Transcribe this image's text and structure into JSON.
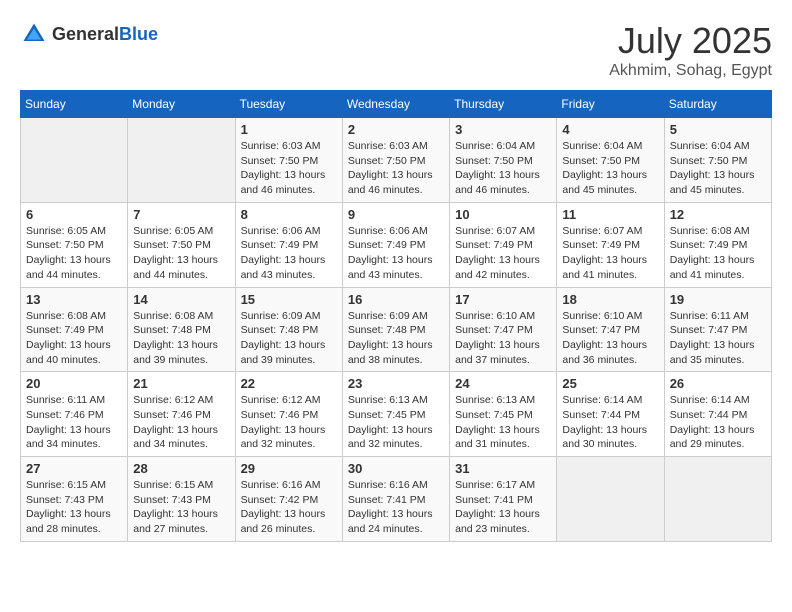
{
  "header": {
    "logo_general": "General",
    "logo_blue": "Blue",
    "title": "July 2025",
    "location": "Akhmim, Sohag, Egypt"
  },
  "weekdays": [
    "Sunday",
    "Monday",
    "Tuesday",
    "Wednesday",
    "Thursday",
    "Friday",
    "Saturday"
  ],
  "weeks": [
    [
      {
        "day": "",
        "empty": true
      },
      {
        "day": "",
        "empty": true
      },
      {
        "day": "1",
        "sunrise": "6:03 AM",
        "sunset": "7:50 PM",
        "daylight": "13 hours and 46 minutes."
      },
      {
        "day": "2",
        "sunrise": "6:03 AM",
        "sunset": "7:50 PM",
        "daylight": "13 hours and 46 minutes."
      },
      {
        "day": "3",
        "sunrise": "6:04 AM",
        "sunset": "7:50 PM",
        "daylight": "13 hours and 46 minutes."
      },
      {
        "day": "4",
        "sunrise": "6:04 AM",
        "sunset": "7:50 PM",
        "daylight": "13 hours and 45 minutes."
      },
      {
        "day": "5",
        "sunrise": "6:04 AM",
        "sunset": "7:50 PM",
        "daylight": "13 hours and 45 minutes."
      }
    ],
    [
      {
        "day": "6",
        "sunrise": "6:05 AM",
        "sunset": "7:50 PM",
        "daylight": "13 hours and 44 minutes."
      },
      {
        "day": "7",
        "sunrise": "6:05 AM",
        "sunset": "7:50 PM",
        "daylight": "13 hours and 44 minutes."
      },
      {
        "day": "8",
        "sunrise": "6:06 AM",
        "sunset": "7:49 PM",
        "daylight": "13 hours and 43 minutes."
      },
      {
        "day": "9",
        "sunrise": "6:06 AM",
        "sunset": "7:49 PM",
        "daylight": "13 hours and 43 minutes."
      },
      {
        "day": "10",
        "sunrise": "6:07 AM",
        "sunset": "7:49 PM",
        "daylight": "13 hours and 42 minutes."
      },
      {
        "day": "11",
        "sunrise": "6:07 AM",
        "sunset": "7:49 PM",
        "daylight": "13 hours and 41 minutes."
      },
      {
        "day": "12",
        "sunrise": "6:08 AM",
        "sunset": "7:49 PM",
        "daylight": "13 hours and 41 minutes."
      }
    ],
    [
      {
        "day": "13",
        "sunrise": "6:08 AM",
        "sunset": "7:49 PM",
        "daylight": "13 hours and 40 minutes."
      },
      {
        "day": "14",
        "sunrise": "6:08 AM",
        "sunset": "7:48 PM",
        "daylight": "13 hours and 39 minutes."
      },
      {
        "day": "15",
        "sunrise": "6:09 AM",
        "sunset": "7:48 PM",
        "daylight": "13 hours and 39 minutes."
      },
      {
        "day": "16",
        "sunrise": "6:09 AM",
        "sunset": "7:48 PM",
        "daylight": "13 hours and 38 minutes."
      },
      {
        "day": "17",
        "sunrise": "6:10 AM",
        "sunset": "7:47 PM",
        "daylight": "13 hours and 37 minutes."
      },
      {
        "day": "18",
        "sunrise": "6:10 AM",
        "sunset": "7:47 PM",
        "daylight": "13 hours and 36 minutes."
      },
      {
        "day": "19",
        "sunrise": "6:11 AM",
        "sunset": "7:47 PM",
        "daylight": "13 hours and 35 minutes."
      }
    ],
    [
      {
        "day": "20",
        "sunrise": "6:11 AM",
        "sunset": "7:46 PM",
        "daylight": "13 hours and 34 minutes."
      },
      {
        "day": "21",
        "sunrise": "6:12 AM",
        "sunset": "7:46 PM",
        "daylight": "13 hours and 34 minutes."
      },
      {
        "day": "22",
        "sunrise": "6:12 AM",
        "sunset": "7:46 PM",
        "daylight": "13 hours and 32 minutes."
      },
      {
        "day": "23",
        "sunrise": "6:13 AM",
        "sunset": "7:45 PM",
        "daylight": "13 hours and 32 minutes."
      },
      {
        "day": "24",
        "sunrise": "6:13 AM",
        "sunset": "7:45 PM",
        "daylight": "13 hours and 31 minutes."
      },
      {
        "day": "25",
        "sunrise": "6:14 AM",
        "sunset": "7:44 PM",
        "daylight": "13 hours and 30 minutes."
      },
      {
        "day": "26",
        "sunrise": "6:14 AM",
        "sunset": "7:44 PM",
        "daylight": "13 hours and 29 minutes."
      }
    ],
    [
      {
        "day": "27",
        "sunrise": "6:15 AM",
        "sunset": "7:43 PM",
        "daylight": "13 hours and 28 minutes."
      },
      {
        "day": "28",
        "sunrise": "6:15 AM",
        "sunset": "7:43 PM",
        "daylight": "13 hours and 27 minutes."
      },
      {
        "day": "29",
        "sunrise": "6:16 AM",
        "sunset": "7:42 PM",
        "daylight": "13 hours and 26 minutes."
      },
      {
        "day": "30",
        "sunrise": "6:16 AM",
        "sunset": "7:41 PM",
        "daylight": "13 hours and 24 minutes."
      },
      {
        "day": "31",
        "sunrise": "6:17 AM",
        "sunset": "7:41 PM",
        "daylight": "13 hours and 23 minutes."
      },
      {
        "day": "",
        "empty": true
      },
      {
        "day": "",
        "empty": true
      }
    ]
  ],
  "labels": {
    "sunrise": "Sunrise:",
    "sunset": "Sunset:",
    "daylight": "Daylight:"
  }
}
